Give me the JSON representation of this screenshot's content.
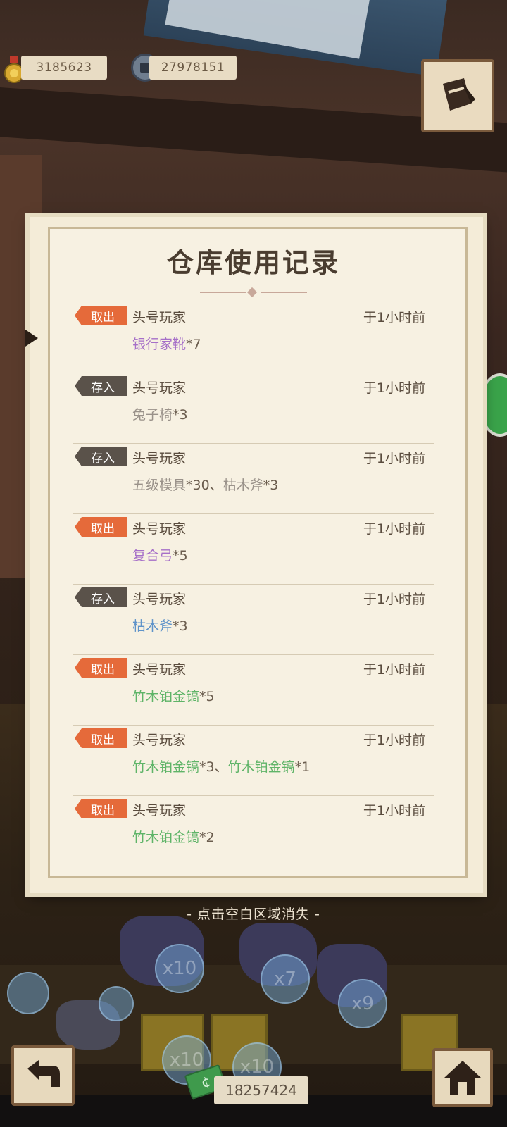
{
  "hud": {
    "medal_value": "3185623",
    "gear_value": "27978151"
  },
  "panel": {
    "title": "仓库使用记录",
    "records": [
      {
        "tag": "取出",
        "tag_type": "out",
        "player": "头号玩家",
        "time": "于1小时前",
        "items": [
          {
            "name": "银行家靴",
            "qty": "*7",
            "color": "purple"
          }
        ]
      },
      {
        "tag": "存入",
        "tag_type": "in",
        "player": "头号玩家",
        "time": "于1小时前",
        "items": [
          {
            "name": "兔子椅",
            "qty": "*3",
            "color": "gray"
          }
        ]
      },
      {
        "tag": "存入",
        "tag_type": "in",
        "player": "头号玩家",
        "time": "于1小时前",
        "items": [
          {
            "name": "五级模具",
            "qty": "*30",
            "color": "gray"
          },
          {
            "name": "枯木斧",
            "qty": "*3",
            "color": "gray"
          }
        ]
      },
      {
        "tag": "取出",
        "tag_type": "out",
        "player": "头号玩家",
        "time": "于1小时前",
        "items": [
          {
            "name": "复合弓",
            "qty": "*5",
            "color": "purple"
          }
        ]
      },
      {
        "tag": "存入",
        "tag_type": "in",
        "player": "头号玩家",
        "time": "于1小时前",
        "items": [
          {
            "name": "枯木斧",
            "qty": "*3",
            "color": "blue"
          }
        ]
      },
      {
        "tag": "取出",
        "tag_type": "out",
        "player": "头号玩家",
        "time": "于1小时前",
        "items": [
          {
            "name": "竹木铂金镐",
            "qty": "*5",
            "color": "green"
          }
        ]
      },
      {
        "tag": "取出",
        "tag_type": "out",
        "player": "头号玩家",
        "time": "于1小时前",
        "items": [
          {
            "name": "竹木铂金镐",
            "qty": "*3",
            "color": "green"
          },
          {
            "name": "竹木铂金镐",
            "qty": "*1",
            "color": "green"
          }
        ]
      },
      {
        "tag": "取出",
        "tag_type": "out",
        "player": "头号玩家",
        "time": "于1小时前",
        "items": [
          {
            "name": "竹木铂金镐",
            "qty": "*2",
            "color": "green"
          }
        ]
      }
    ],
    "item_separator": "、"
  },
  "dismiss_hint": "- 点击空白区域消失 -",
  "bottom": {
    "money_value": "18257424",
    "bubble_labels": [
      "x10",
      "x7",
      "x9",
      "x10",
      "x10"
    ]
  },
  "icons": {
    "medal": "medal-icon",
    "gear_coin": "gear-coin-icon",
    "top_right": "journal-feather-icon",
    "back": "back-arrow-icon",
    "home": "home-icon",
    "money": "banknote-icon"
  },
  "colors": {
    "tag_out": "#e56a3a",
    "tag_in": "#5a524a",
    "item_purple": "#a66fc8",
    "item_gray": "#9a928a",
    "item_blue": "#5f93c9",
    "item_green": "#5fb468"
  }
}
